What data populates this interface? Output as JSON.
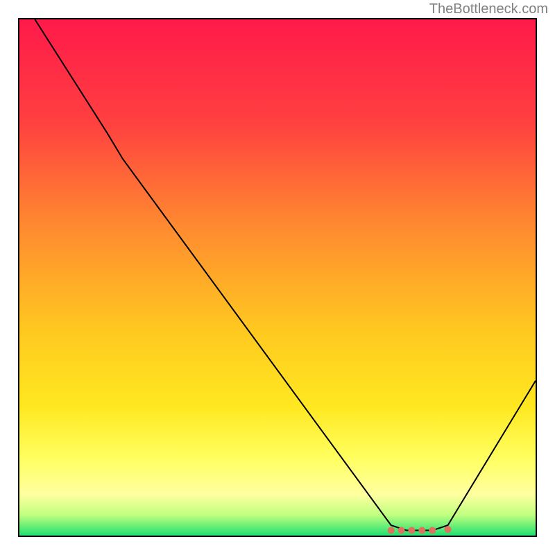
{
  "watermark": "TheBottleneck.com",
  "chart_data": {
    "type": "line",
    "title": "",
    "xlabel": "",
    "ylabel": "",
    "xlim": [
      0,
      100
    ],
    "ylim": [
      0,
      100
    ],
    "gradient": {
      "stops": [
        {
          "offset": 0,
          "color": "#ff1a4a"
        },
        {
          "offset": 20,
          "color": "#ff4040"
        },
        {
          "offset": 40,
          "color": "#ff8a30"
        },
        {
          "offset": 60,
          "color": "#ffc820"
        },
        {
          "offset": 75,
          "color": "#ffe820"
        },
        {
          "offset": 85,
          "color": "#ffff60"
        },
        {
          "offset": 92,
          "color": "#ffffa0"
        },
        {
          "offset": 96,
          "color": "#c0ff80"
        },
        {
          "offset": 100,
          "color": "#20e070"
        }
      ]
    },
    "curve": [
      {
        "x": 3,
        "y": 100
      },
      {
        "x": 17,
        "y": 78
      },
      {
        "x": 20,
        "y": 73
      },
      {
        "x": 72,
        "y": 2
      },
      {
        "x": 75,
        "y": 1
      },
      {
        "x": 80,
        "y": 1
      },
      {
        "x": 83,
        "y": 2
      },
      {
        "x": 100,
        "y": 30
      }
    ],
    "markers": [
      {
        "x": 72,
        "y": 1
      },
      {
        "x": 74,
        "y": 1
      },
      {
        "x": 76,
        "y": 1
      },
      {
        "x": 78,
        "y": 1
      },
      {
        "x": 80,
        "y": 1
      },
      {
        "x": 83,
        "y": 1.2
      }
    ],
    "marker_color": "#e07060"
  }
}
